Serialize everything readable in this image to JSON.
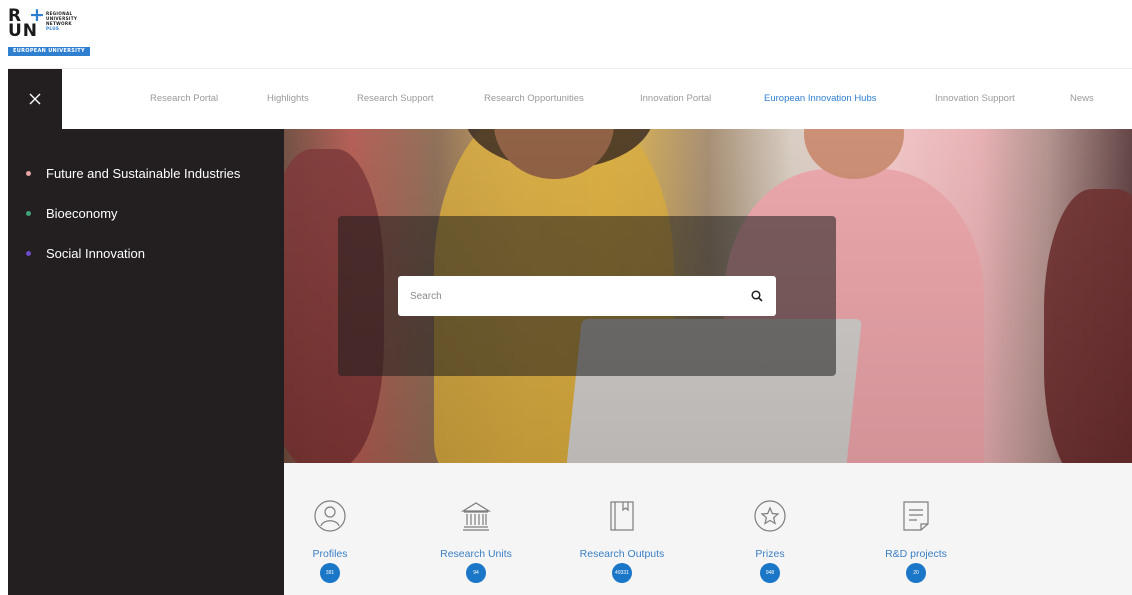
{
  "logo": {
    "mark_top": "R",
    "mark_plus": "+",
    "mark_bottom": "UN",
    "line1": "REGIONAL",
    "line2": "UNIVERSITY",
    "line3": "NETWORK",
    "line4": "PLUS",
    "strip": "EUROPEAN UNIVERSITY"
  },
  "nav": {
    "close_icon": "close-icon",
    "items": [
      {
        "label": "Research Portal",
        "active": false
      },
      {
        "label": "Highlights",
        "active": false
      },
      {
        "label": "Research Support",
        "active": false
      },
      {
        "label": "Research Opportunities",
        "active": false
      },
      {
        "label": "Innovation Portal",
        "active": false
      },
      {
        "label": "European Innovation Hubs",
        "active": true
      },
      {
        "label": "Innovation Support",
        "active": false
      },
      {
        "label": "News",
        "active": false
      }
    ]
  },
  "sidebar": {
    "items": [
      {
        "label": "Future and Sustainable Industries",
        "dot_color": "#e8a3a3"
      },
      {
        "label": "Bioeconomy",
        "dot_color": "#3fa37a"
      },
      {
        "label": "Social Innovation",
        "dot_color": "#6a4cc9"
      }
    ]
  },
  "search": {
    "placeholder": "Search",
    "icon": "search-icon"
  },
  "stats": [
    {
      "label": "Profiles",
      "count": "391",
      "icon": "profile-icon"
    },
    {
      "label": "Research Units",
      "count": "94",
      "icon": "institution-icon"
    },
    {
      "label": "Research Outputs",
      "count": "49331",
      "icon": "book-icon"
    },
    {
      "label": "Prizes",
      "count": "948",
      "icon": "star-icon"
    },
    {
      "label": "R&D projects",
      "count": "20",
      "icon": "document-icon"
    }
  ],
  "colors": {
    "accent": "#2f7fd1",
    "sidebar_bg": "#231f20",
    "badge": "#1a76c7"
  }
}
